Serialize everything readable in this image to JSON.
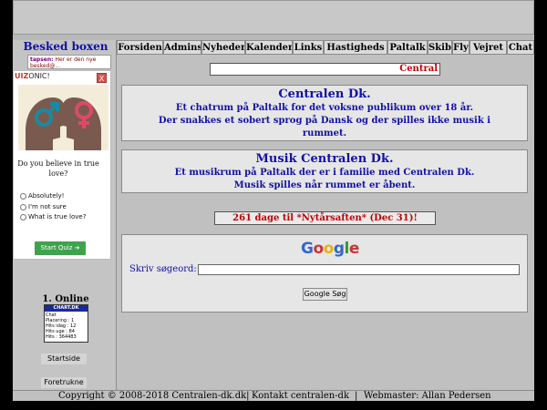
{
  "left": {
    "besked_title": "Besked boxen",
    "besked_user": "tapsen:",
    "besked_text": "Her er den nye",
    "besked_text2": "besked@...",
    "online_title": "1. Online",
    "chart": {
      "header": "CHART.DK",
      "lines": [
        "Chat",
        "Placering : 1",
        "Hits idag : 12",
        "Hits uge : 84",
        "Hits : 364483"
      ]
    },
    "links": [
      "Startside",
      "Foretrukne"
    ]
  },
  "quiz": {
    "logo_q": "UIZ",
    "logo_rest": "ONIC!",
    "close": "X",
    "question": "Do you believe in true love?",
    "options": [
      "Absolutely!",
      "I'm not sure",
      "What is true love?"
    ],
    "start": "Start Quiz ➔",
    "colors": {
      "male": "#1a8aa0",
      "female": "#e0486a"
    }
  },
  "nav": {
    "items": [
      "Forsiden",
      "Admins",
      "Nyheder",
      "Kalender",
      "Links",
      "Hastigheds",
      "Paltalk",
      "Skib",
      "Fly",
      "Vejret",
      "Chat"
    ]
  },
  "main": {
    "central_label": "Central",
    "panel1": {
      "heading": "Centralen Dk.",
      "line1": "Et chatrum på Paltalk for det voksne publikum over 18 år.",
      "line2": "Der snakkes et sobert sprog på Dansk og der spilles ikke musik i",
      "line3": "rummet."
    },
    "panel2": {
      "heading": "Musik Centralen Dk.",
      "line1": "Et musikrum på Paltalk der er i familie med Centralen Dk.",
      "line2": "Musik spilles når rummet er åbent."
    },
    "countdown": "261 dage til *Nytårsaften* (Dec 31)!",
    "search": {
      "logo_letters": [
        "G",
        "o",
        "o",
        "g",
        "l",
        "e"
      ],
      "logo_colors": [
        "#3366cc",
        "#cc3333",
        "#e8b10e",
        "#3366cc",
        "#339933",
        "#cc3333"
      ],
      "label": "Skriv søgeord:",
      "value": "",
      "button": "Google Søg"
    }
  },
  "footer": {
    "copyright": "Copyright © 2008-2018 Centralen-dk.dk|",
    "contact": "Kontakt centralen-dk",
    "sep": "|",
    "webmaster": "Webmaster: Allan Pedersen"
  }
}
